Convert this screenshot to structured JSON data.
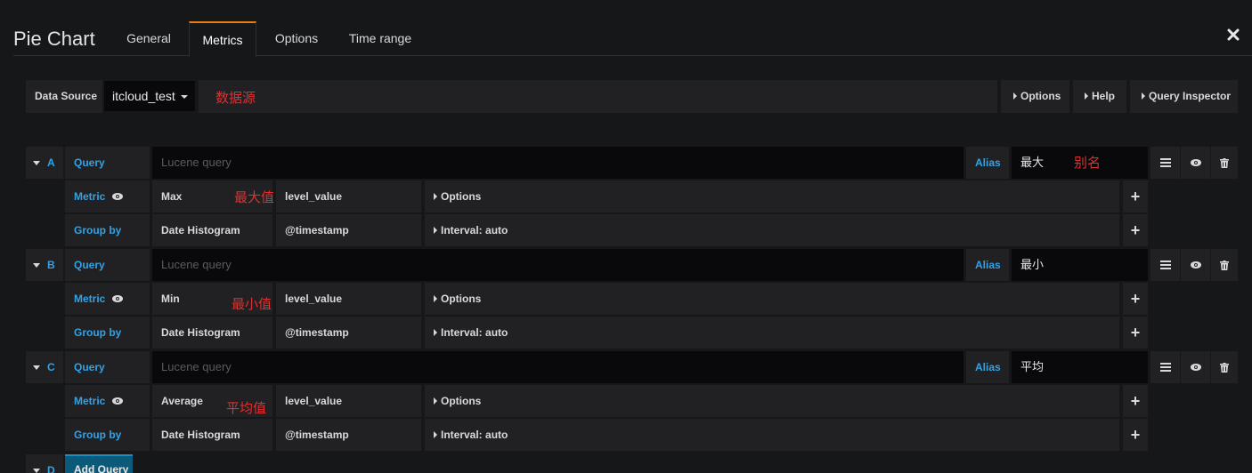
{
  "header": {
    "title": "Pie Chart",
    "tabs": [
      {
        "label": "General"
      },
      {
        "label": "Metrics"
      },
      {
        "label": "Options"
      },
      {
        "label": "Time range"
      }
    ],
    "active_tab": "Metrics"
  },
  "datasource": {
    "label": "Data Source",
    "value": "itcloud_test",
    "annotation": "数据源",
    "buttons": [
      "Options",
      "Help",
      "Query Inspector"
    ]
  },
  "queries": [
    {
      "ref": "A",
      "query_label": "Query",
      "query_placeholder": "Lucene query",
      "alias_label": "Alias",
      "alias_value": "最大",
      "alias_annotation": "别名",
      "metric_label": "Metric",
      "metric_type": "Max",
      "metric_annotation": "最大值",
      "metric_field": "level_value",
      "metric_options": "Options",
      "groupby_label": "Group by",
      "groupby_type": "Date Histogram",
      "groupby_field": "@timestamp",
      "groupby_interval": "Interval: auto"
    },
    {
      "ref": "B",
      "query_label": "Query",
      "query_placeholder": "Lucene query",
      "alias_label": "Alias",
      "alias_value": "最小",
      "metric_label": "Metric",
      "metric_type": "Min",
      "metric_annotation": "最小值",
      "metric_field": "level_value",
      "metric_options": "Options",
      "groupby_label": "Group by",
      "groupby_type": "Date Histogram",
      "groupby_field": "@timestamp",
      "groupby_interval": "Interval: auto"
    },
    {
      "ref": "C",
      "query_label": "Query",
      "query_placeholder": "Lucene query",
      "alias_label": "Alias",
      "alias_value": "平均",
      "metric_label": "Metric",
      "metric_type": "Average",
      "metric_annotation": "平均值",
      "metric_field": "level_value",
      "metric_options": "Options",
      "groupby_label": "Group by",
      "groupby_type": "Date Histogram",
      "groupby_field": "@timestamp",
      "groupby_interval": "Interval: auto"
    }
  ],
  "next_ref": "D",
  "add_query_label": "Add Query",
  "icons": {
    "close": "close-icon",
    "menu": "hamburger-icon",
    "eye": "eye-icon",
    "trash": "trash-icon",
    "plus": "plus-icon"
  },
  "colors": {
    "background": "#161719",
    "panel": "#212124",
    "input": "#09090b",
    "accent_blue": "#33a2e5",
    "active_tab": "#eb7b18",
    "annotation": "#e02f2f",
    "add_button": "#0c5a7a"
  }
}
